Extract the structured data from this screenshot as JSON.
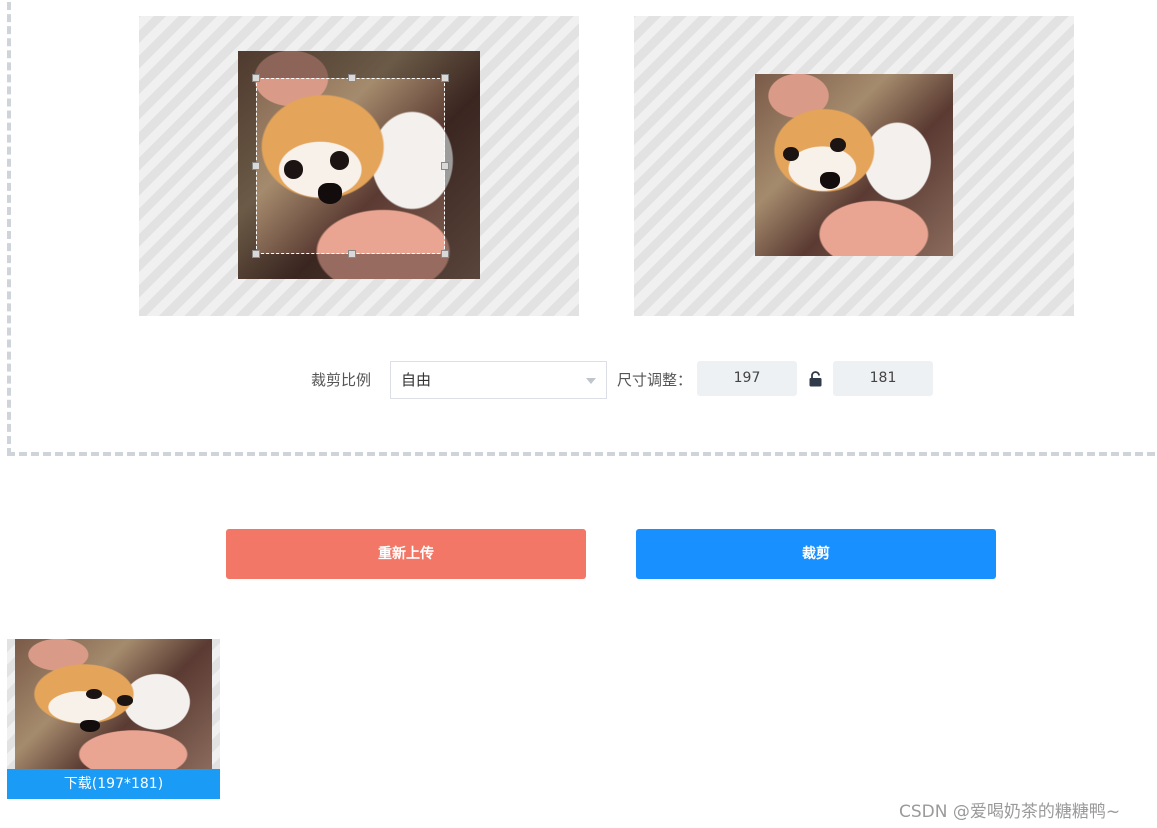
{
  "controls": {
    "ratio_label": "裁剪比例",
    "ratio_selected": "自由",
    "size_label": "尺寸调整：",
    "width_value": "197",
    "height_value": "181"
  },
  "buttons": {
    "reupload_label": "重新上传",
    "crop_label": "裁剪"
  },
  "result": {
    "download_label": "下载(197*181)"
  },
  "watermark": {
    "text": "CSDN @爱喝奶茶的糖糖鸭~"
  },
  "icons": {
    "lock": "lock-open-icon",
    "dropdown": "chevron-down-icon"
  },
  "colors": {
    "reupload": "#f27766",
    "crop": "#1890ff",
    "download": "#1a9bf6",
    "dashed_border": "#cfd4da"
  }
}
